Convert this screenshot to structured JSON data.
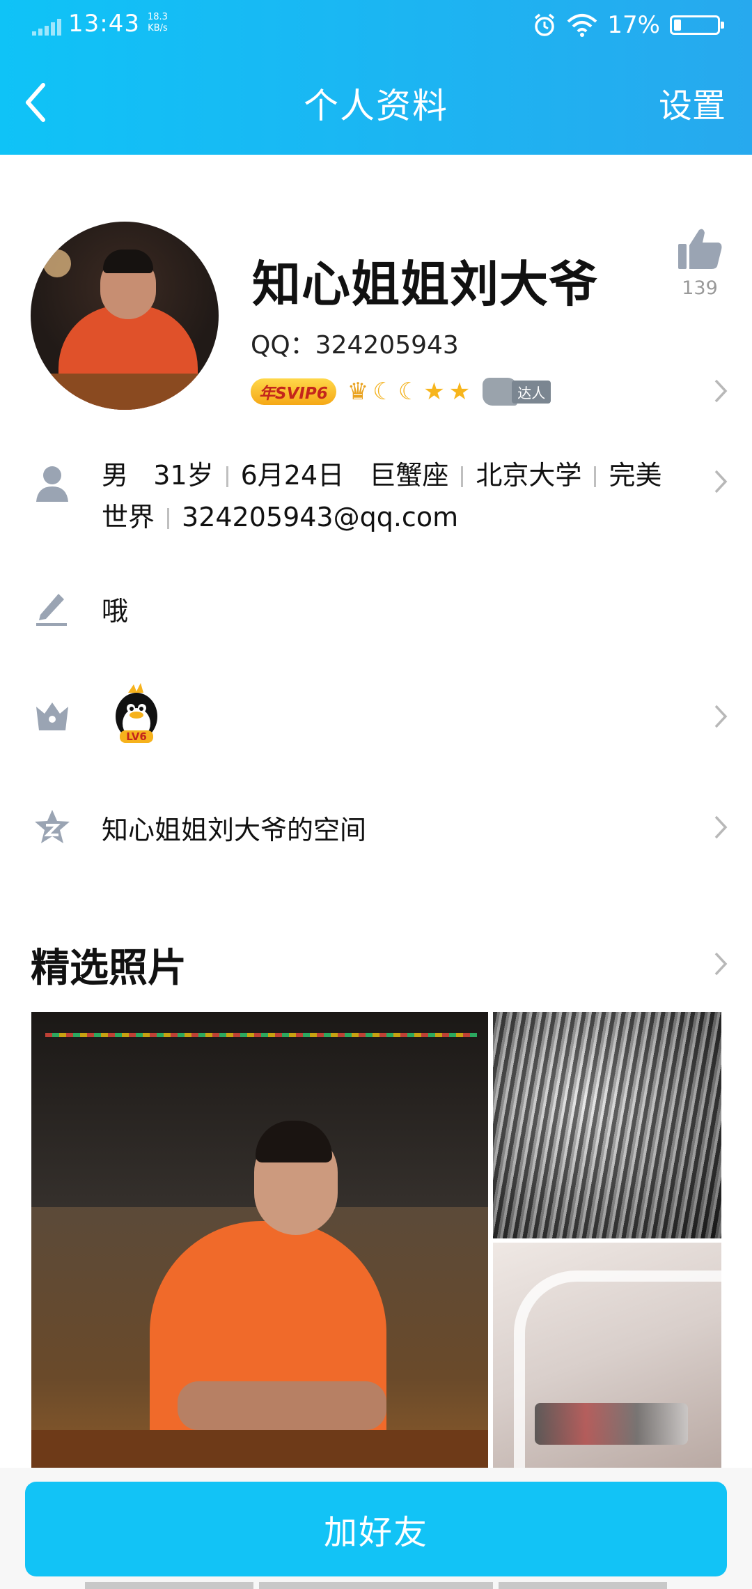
{
  "status_bar": {
    "time": "13:43",
    "net_speed": "18.3",
    "net_unit": "KB/s",
    "battery": "17%",
    "battery_level": 0.17
  },
  "nav": {
    "title": "个人资料",
    "settings": "设置"
  },
  "profile": {
    "nickname": "知心姐姐刘大爷",
    "qq_label": "QQ：324205943",
    "likes": "139",
    "svip_badge": "年SVIP6",
    "daren_badge": "达人"
  },
  "info": {
    "gender": "男",
    "age": "31岁",
    "birthday": "6月24日",
    "zodiac": "巨蟹座",
    "school": "北京大学",
    "company": "完美世界",
    "email": "324205943@qq.com"
  },
  "signature": "哦",
  "level_badge": "LV6",
  "space": "知心姐姐刘大爷的空间",
  "photos": {
    "title": "精选照片"
  },
  "bottom": {
    "add_friend": "加好友"
  }
}
